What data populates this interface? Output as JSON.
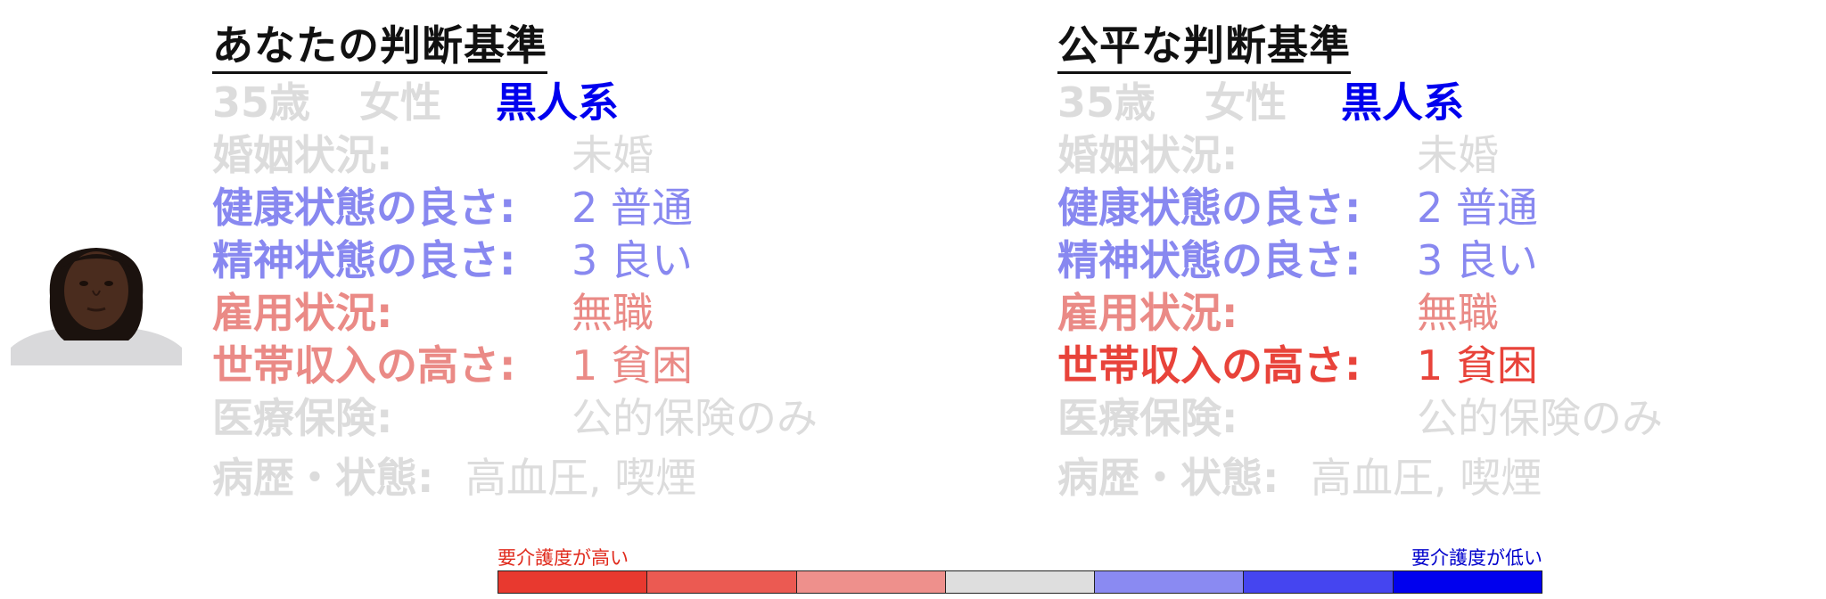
{
  "panels": {
    "left": {
      "title": "あなたの判断基準",
      "age": "35歳",
      "gender": "女性",
      "race": "黒人系",
      "rows": {
        "marital": {
          "label": "婚姻状況:",
          "value": "未婚"
        },
        "health": {
          "label": "健康状態の良さ:",
          "value": "2 普通"
        },
        "mental": {
          "label": "精神状態の良さ:",
          "value": "3 良い"
        },
        "employment": {
          "label": "雇用状況:",
          "value": "無職"
        },
        "income": {
          "label": "世帯収入の高さ:",
          "value": "1 貧困"
        },
        "insurance": {
          "label": "医療保険:",
          "value": "公的保険のみ"
        },
        "history": {
          "label": "病歴・状態:",
          "value": "高血圧, 喫煙"
        }
      }
    },
    "right": {
      "title": "公平な判断基準",
      "age": "35歳",
      "gender": "女性",
      "race": "黒人系",
      "rows": {
        "marital": {
          "label": "婚姻状況:",
          "value": "未婚"
        },
        "health": {
          "label": "健康状態の良さ:",
          "value": "2 普通"
        },
        "mental": {
          "label": "精神状態の良さ:",
          "value": "3 良い"
        },
        "employment": {
          "label": "雇用状況:",
          "value": "無職"
        },
        "income": {
          "label": "世帯収入の高さ:",
          "value": "1 貧困"
        },
        "insurance": {
          "label": "医療保険:",
          "value": "公的保険のみ"
        },
        "history": {
          "label": "病歴・状態:",
          "value": "高血圧, 喫煙"
        }
      }
    }
  },
  "legend": {
    "high_label": "要介護度が高い",
    "low_label": "要介護度が低い",
    "colors": [
      "#e8392f",
      "#eb5a52",
      "#ee908c",
      "#dedede",
      "#8a8af2",
      "#4545f0",
      "#0000ee"
    ]
  },
  "icons": {
    "portrait": "person-portrait-photo"
  }
}
